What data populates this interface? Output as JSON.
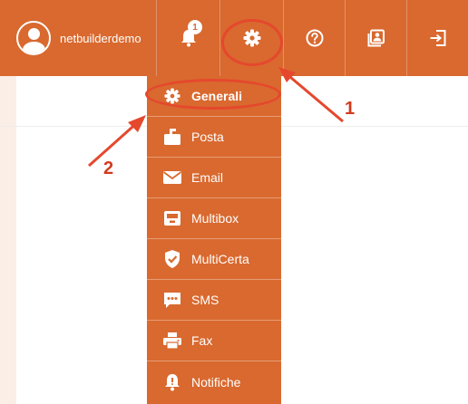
{
  "user": {
    "name": "netbuilderdemo",
    "avatar_icon": "user-avatar-icon"
  },
  "toolbar": {
    "notifications": {
      "icon": "bell-icon",
      "count": "1"
    },
    "settings": {
      "icon": "gear-icon"
    },
    "help": {
      "icon": "question-circle-icon"
    },
    "contacts": {
      "icon": "address-book-icon"
    },
    "logout": {
      "icon": "sign-out-icon"
    }
  },
  "settings_menu": {
    "items": [
      {
        "label": "Generali",
        "icon": "gear-icon"
      },
      {
        "label": "Posta",
        "icon": "mailbox-icon"
      },
      {
        "label": "Email",
        "icon": "envelope-icon"
      },
      {
        "label": "Multibox",
        "icon": "inbox-tray-icon"
      },
      {
        "label": "MultiCerta",
        "icon": "shield-check-icon"
      },
      {
        "label": "SMS",
        "icon": "chat-bubble-icon"
      },
      {
        "label": "Fax",
        "icon": "printer-icon"
      },
      {
        "label": "Notifiche",
        "icon": "alert-bell-icon"
      }
    ]
  },
  "annotations": {
    "step1": "1",
    "step2": "2"
  },
  "colors": {
    "brand": "#d9692f",
    "annotation": "#e5482d",
    "white": "#ffffff"
  }
}
